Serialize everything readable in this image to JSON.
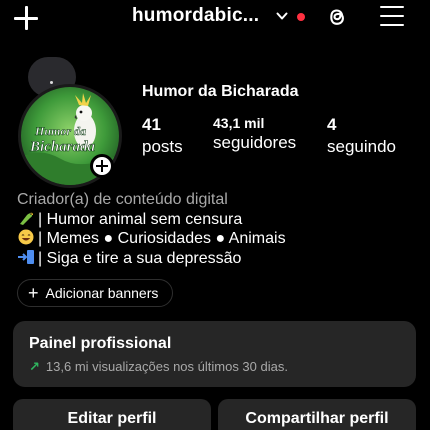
{
  "header": {
    "username": "humordabic...",
    "has_notification": true,
    "colors": {
      "notification_dot": "#ff3040"
    }
  },
  "profile": {
    "full_name": "Humor da Bicharada",
    "avatar_text_line1": "Humor da",
    "avatar_text_line2": "Bicharada",
    "stats": {
      "posts_count": "41",
      "posts_label": "posts",
      "followers_count": "43,1 mil",
      "followers_label": "seguidores",
      "following_count": "4",
      "following_label": "seguindo"
    }
  },
  "bio": {
    "category": "Criador(a) de conteúdo digital",
    "lines": [
      {
        "icon": "parrot-emoji-icon",
        "text": "| Humor animal sem censura"
      },
      {
        "icon": "grinning-emoji-icon",
        "text": "| Memes ● Curiosidades ● Animais"
      },
      {
        "icon": "door-arrow-emoji-icon",
        "text": "| Siga e tire a sua depressão"
      }
    ]
  },
  "banners": {
    "label": "Adicionar banners"
  },
  "professional_panel": {
    "title": "Painel profissional",
    "subtitle": "13,6 mi visualizações nos últimos 30 dias.",
    "colors": {
      "trend_arrow": "#2fb65f"
    }
  },
  "actions": {
    "edit_label": "Editar perfil",
    "share_label": "Compartilhar perfil"
  }
}
